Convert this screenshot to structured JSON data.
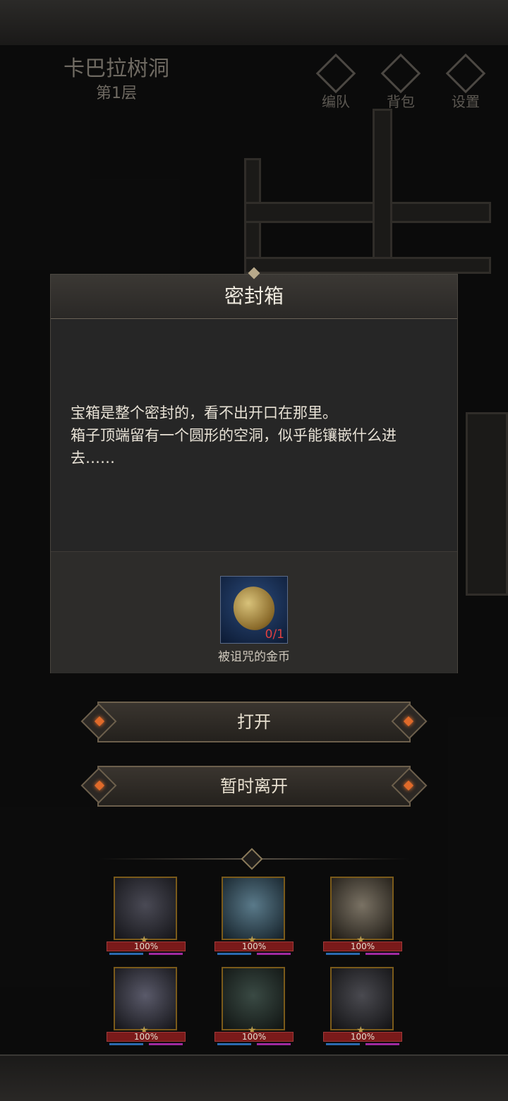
{
  "location": {
    "name": "卡巴拉树洞",
    "floor": "第1层"
  },
  "top_buttons": [
    {
      "label": "编队",
      "icon": "team-icon"
    },
    {
      "label": "背包",
      "icon": "bag-icon"
    },
    {
      "label": "设置",
      "icon": "gear-icon"
    }
  ],
  "dialog": {
    "title": "密封箱",
    "description": [
      "宝箱是整个密封的，看不出开口在那里。",
      "箱子顶端留有一个圆形的空洞，似乎能镶嵌什么进去……"
    ],
    "required_item": {
      "name": "被诅咒的金币",
      "count": "0/1",
      "icon": "cursed-coin-icon"
    }
  },
  "actions": {
    "open_label": "打开",
    "leave_label": "暂时离开"
  },
  "party": [
    {
      "hp": "100%"
    },
    {
      "hp": "100%"
    },
    {
      "hp": "100%"
    },
    {
      "hp": "100%"
    },
    {
      "hp": "100%"
    },
    {
      "hp": "100%"
    }
  ],
  "colors": {
    "accent": "#e06a2a",
    "hp_bar": "#7a1a1a",
    "count_warning": "#e04040"
  }
}
